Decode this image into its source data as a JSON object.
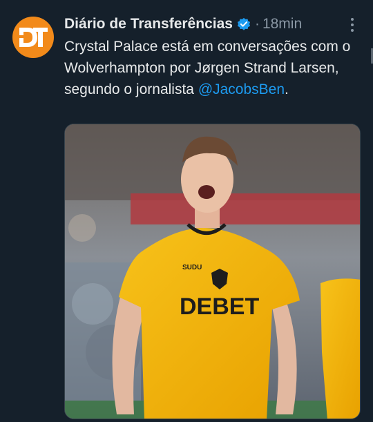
{
  "tweet": {
    "author_name": "Diário de Transferências",
    "avatar_text": "DT",
    "separator": "·",
    "time": "18min",
    "text_before": "Crystal Palace está em conversações com o Wolverhampton por Jørgen Strand Larsen, segundo o jornalista ",
    "mention": "@JacobsBen",
    "text_after": ".",
    "verified": true
  },
  "media": {
    "shirt_sponsor": "DEBET",
    "shirt_brand": "SUDU"
  },
  "colors": {
    "background": "#15202b",
    "text": "#e7e9ea",
    "muted": "#8b98a5",
    "link": "#1d9bf0",
    "avatar": "#f28a1a",
    "shirt": "#f5b400"
  },
  "icons": [
    "verified-badge-icon",
    "more-options-icon"
  ]
}
